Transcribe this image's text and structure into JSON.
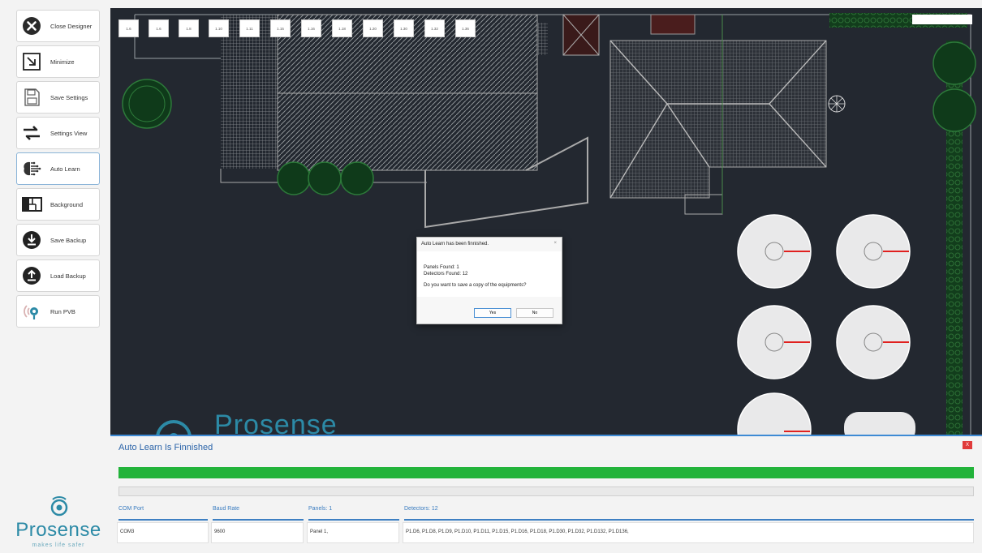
{
  "sidebar": {
    "items": [
      {
        "label": "Close Designer",
        "icon": "close-circle-icon"
      },
      {
        "label": "Minimize",
        "icon": "minimize-arrow-icon"
      },
      {
        "label": "Save Settings",
        "icon": "save-document-icon"
      },
      {
        "label": "Settings View",
        "icon": "swap-arrows-icon"
      },
      {
        "label": "Auto Learn",
        "icon": "brain-icon"
      },
      {
        "label": "Background",
        "icon": "floorplan-icon"
      },
      {
        "label": "Save Backup",
        "icon": "download-circle-icon"
      },
      {
        "label": "Load Backup",
        "icon": "upload-circle-icon"
      },
      {
        "label": "Run PVB",
        "icon": "broadcast-icon"
      }
    ]
  },
  "logo": {
    "brand": "Prosense",
    "tagline": "makes life safer"
  },
  "canvas": {
    "tiles": [
      "1.6",
      "1.6",
      "1.8",
      "1.10",
      "1.11",
      "1.15",
      "1.16",
      "1.18",
      "1.20",
      "1.30",
      "1.32",
      "1.36"
    ],
    "watermark": "Prosense"
  },
  "dialog": {
    "title": "Auto Learn has been finnished.",
    "close": "×",
    "line1": "Panels Found: 1",
    "line2": "Detectors Found: 12",
    "question": "Do you want to save a copy of the equipments?",
    "yes": "Yes",
    "no": "No"
  },
  "status": {
    "title": "Auto Learn Is Finnished",
    "close": "X",
    "progress": 1.0,
    "columns": [
      {
        "header": "COM Port",
        "value": "COM3"
      },
      {
        "header": "Baud Rate",
        "value": "9600"
      },
      {
        "header": "Panels: 1",
        "value": "Panel 1,"
      },
      {
        "header": "Detectors: 12",
        "value": "P1.D6, P1.D8, P1.D9, P1.D10, P1.D11, P1.D15, P1.D16, P1.D18, P1.D30, P1.D32, P1.D132, P1.D136,"
      }
    ]
  },
  "colors": {
    "accent": "#3d8ad4",
    "progress": "#22b33a",
    "canvas_bg": "#232830",
    "brand": "#2c8aa6",
    "close_red": "#e03a3a"
  }
}
